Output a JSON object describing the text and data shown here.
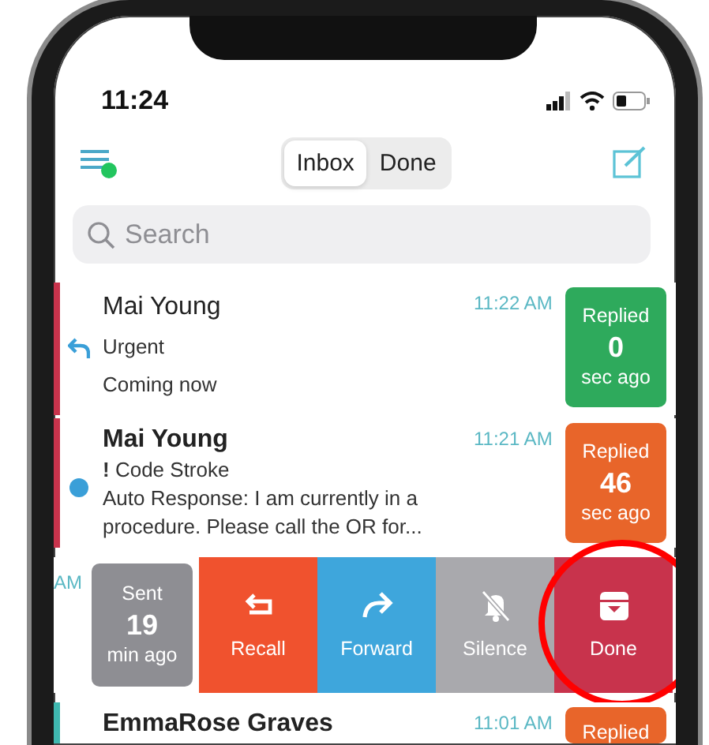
{
  "status_bar": {
    "time": "11:24"
  },
  "nav": {
    "tabs": [
      {
        "label": "Inbox",
        "selected": true
      },
      {
        "label": "Done",
        "selected": false
      }
    ]
  },
  "search": {
    "placeholder": "Search"
  },
  "messages": [
    {
      "kind": "message",
      "color": "#c8334c",
      "replied": true,
      "sender": "Mai Young",
      "unread": false,
      "time": "11:22 AM",
      "subject": "Urgent",
      "preview": "Coming now",
      "badge": {
        "label": "Replied",
        "count": "0",
        "unit": "sec ago",
        "color": "#2eaa5c"
      }
    },
    {
      "kind": "message",
      "color": "#c8334c",
      "replied": false,
      "sender": "Mai Young",
      "unread": true,
      "time": "11:21 AM",
      "subject": "**!** Code Stroke",
      "preview": "Auto Response: I am currently in a procedure. Please call the OR for...",
      "badge": {
        "label": "Replied",
        "count": "46",
        "unit": "sec ago",
        "color": "#e8652a"
      }
    },
    {
      "kind": "swiped",
      "time": "AM",
      "badge": {
        "label": "Sent",
        "count": "19",
        "unit": "min ago",
        "color": "#8e8e93"
      },
      "actions": [
        {
          "label": "Recall",
          "color": "#f0522e",
          "circled": false
        },
        {
          "label": "Forward",
          "color": "#3ea6dc",
          "circled": false
        },
        {
          "label": "Silence",
          "color": "#a9a9ad",
          "circled": false
        },
        {
          "label": "Done",
          "color": "#c8334c",
          "circled": true
        }
      ]
    },
    {
      "kind": "message",
      "color": "#3fb8b0",
      "replied": false,
      "sender": "EmmaRose Graves",
      "unread": true,
      "time": "11:01 AM",
      "badge": {
        "label": "Replied",
        "color": "#e8652a"
      }
    }
  ]
}
